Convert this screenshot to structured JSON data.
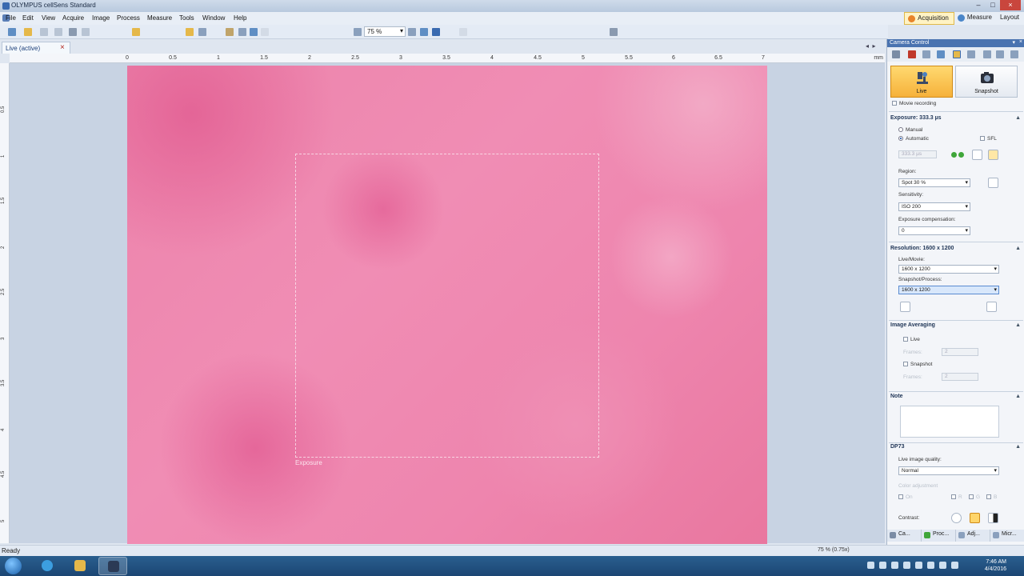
{
  "window": {
    "title": "OLYMPUS cellSens Standard"
  },
  "menu": [
    "File",
    "Edit",
    "View",
    "Acquire",
    "Image",
    "Process",
    "Measure",
    "Tools",
    "Window",
    "Help"
  ],
  "layout_tabs": {
    "acquisition": "Acquisition",
    "measure": "Measure",
    "layout": "Layout"
  },
  "toolbar": {
    "zoom": "75 %"
  },
  "document_tab": {
    "label": "Live (active)"
  },
  "ruler": {
    "h_ticks": [
      "0",
      "0.5",
      "1",
      "1.5",
      "2",
      "2.5",
      "3",
      "3.5",
      "4",
      "4.5",
      "5",
      "5.5",
      "6",
      "6.5",
      "7"
    ],
    "unit": "mm",
    "v_ticks": [
      "0.5",
      "1",
      "1.5",
      "2",
      "2.5",
      "3",
      "3.5",
      "4",
      "4.5",
      "5"
    ]
  },
  "canvas": {
    "roi_label": "Exposure"
  },
  "status": {
    "text": "Ready",
    "zoom": "75 % (0.75x)"
  },
  "taskbar": {
    "time": "7:46 AM",
    "date": "4/4/2016"
  },
  "panel": {
    "title": "Camera Control",
    "live_label": "Live",
    "snapshot_label": "Snapshot",
    "movie_recording": "Movie recording",
    "exposure": {
      "title": "Exposure: 333.3 µs",
      "manual": "Manual",
      "automatic": "Automatic",
      "sfl": "SFL",
      "value": "333.3 µs",
      "region_label": "Region:",
      "region_value": "Spot 30 %",
      "sensitivity_label": "Sensitivity:",
      "sensitivity_value": "ISO 200",
      "comp_label": "Exposure compensation:",
      "comp_value": "0"
    },
    "resolution": {
      "title": "Resolution: 1600 x 1200",
      "live_label": "Live/Movie:",
      "live_value": "1600 x 1200",
      "snap_label": "Snapshot/Process:",
      "snap_value": "1600 x 1200"
    },
    "averaging": {
      "title": "Image Averaging",
      "live": "Live",
      "live_frames_label": "Frames:",
      "live_frames": "2",
      "snapshot": "Snapshot",
      "snap_frames_label": "Frames:",
      "snap_frames": "2"
    },
    "note": {
      "title": "Note"
    },
    "dp73": {
      "title": "DP73",
      "quality_label": "Live image quality:",
      "quality_value": "Normal",
      "color_label": "Color adjustment",
      "on": "On",
      "r": "R",
      "g": "G",
      "b": "B",
      "contrast_label": "Contrast:"
    },
    "bottom_tabs": [
      "Ca...",
      "Proc...",
      "Adj...",
      "Micr..."
    ]
  }
}
